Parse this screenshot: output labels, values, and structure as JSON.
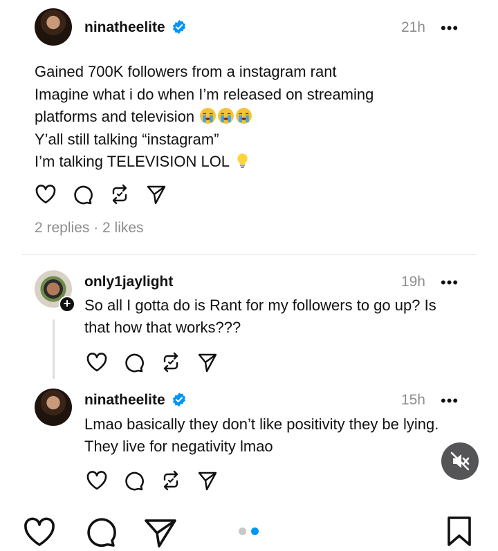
{
  "post": {
    "username": "ninatheelite",
    "verified": true,
    "time": "21h",
    "more": "•••",
    "lines": [
      "Gained 700K followers from a instagram rant",
      "Imagine what i do when I’m released on streaming",
      "platforms and television",
      "Y’all still talking “instagram”",
      "I’m talking TELEVISION LOL"
    ],
    "line3_emojis": [
      "loudly-crying-emoji",
      "loudly-crying-emoji",
      "loudly-crying-emoji"
    ],
    "line5_emoji": "light-bulb-emoji",
    "replies_text": "2 replies · 2 likes"
  },
  "replies": [
    {
      "username": "only1jaylight",
      "time": "19h",
      "more": "•••",
      "has_follow_badge": true,
      "follow_badge": "+",
      "lines": [
        "So all I gotta do is Rant for my followers to go up? Is",
        "that how that works???"
      ]
    },
    {
      "username": "ninatheelite",
      "verified": true,
      "time": "15h",
      "more": "•••",
      "lines": [
        "Lmao basically they don’t like positivity they be lying.",
        "They live for negativity lmao"
      ]
    }
  ],
  "icons": {
    "like": "heart-icon",
    "reply": "comment-icon",
    "repost": "repost-icon",
    "share": "send-icon",
    "mute": "speaker-muted-icon",
    "save": "bookmark-icon"
  },
  "pager": {
    "count": 2,
    "active": 1
  },
  "colors": {
    "verified": "#0095f6",
    "active_dot": "#0095f6",
    "inactive_dot": "#c7c7c7",
    "meta_gray": "#8e8e8e"
  }
}
